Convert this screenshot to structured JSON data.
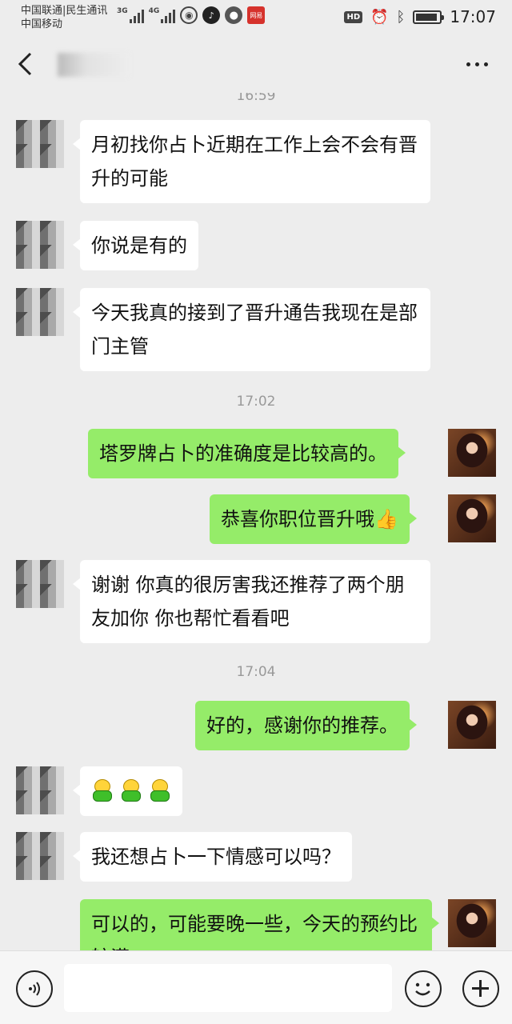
{
  "status_bar": {
    "carrier_1": "中国联通|民生通讯",
    "carrier_2": "中国移动",
    "net_1": "3G",
    "net_2": "4G",
    "netease_label": "网易",
    "hd": "HD",
    "battery_level": 0.9,
    "time": "17:07"
  },
  "messages": [
    {
      "side": "in",
      "text": "月初找你占卜近期在工作上会不会有晋升的可能"
    },
    {
      "side": "in",
      "text": "你说是有的"
    },
    {
      "side": "in",
      "text": "今天我真的接到了晋升通告我现在是部门主管"
    },
    {
      "side": "time",
      "text": "17:02"
    },
    {
      "side": "out",
      "text": "塔罗牌占卜的准确度是比较高的。"
    },
    {
      "side": "out",
      "text": "恭喜你职位晋升哦",
      "emoji": "👍"
    },
    {
      "side": "in",
      "text": "谢谢 你真的很厉害我还推荐了两个朋友加你 你也帮忙看看吧"
    },
    {
      "side": "time",
      "text": "17:04"
    },
    {
      "side": "out",
      "text": "好的，感谢你的推荐。"
    },
    {
      "side": "in",
      "stickers": [
        "green-figure",
        "green-figure",
        "green-figure"
      ]
    },
    {
      "side": "in",
      "text": "我还想占卜一下情感可以吗？"
    },
    {
      "side": "out",
      "text": "可以的，可能要晚一些，今天的预约比较满。"
    }
  ],
  "colors": {
    "background": "#ededed",
    "incoming_bubble": "#ffffff",
    "outgoing_bubble": "#95ec69",
    "timestamp": "#999999"
  },
  "icons": [
    "back-arrow-icon",
    "more-icon",
    "voice-icon",
    "emoji-icon",
    "plus-icon"
  ]
}
